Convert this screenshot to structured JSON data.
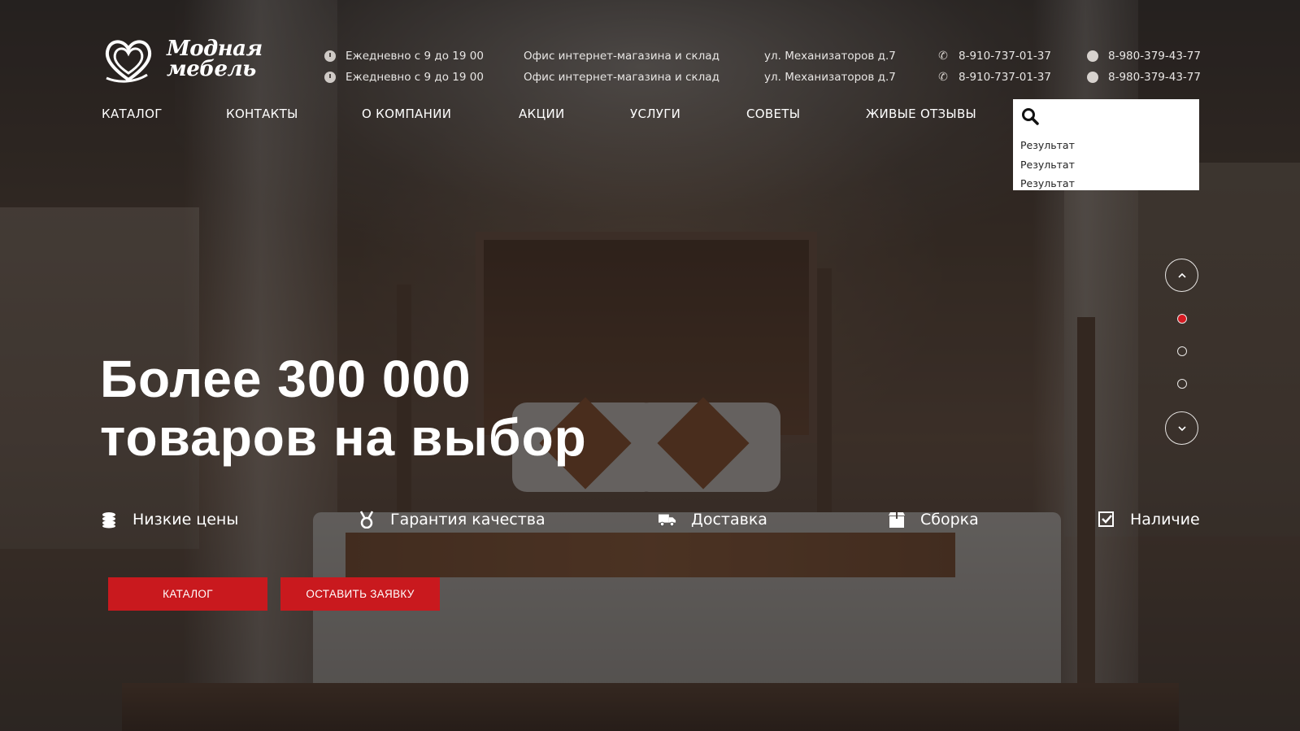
{
  "brand": {
    "line1": "Модная",
    "line2": "мебель"
  },
  "contacts": {
    "hours": [
      "Ежедневно с 9 до 19 00",
      "Ежедневно с 9 до 19 00"
    ],
    "office": [
      "Офис интернет-магазина и склад",
      "Офис интернет-магазина и склад"
    ],
    "address": [
      "ул. Механизаторов д.7",
      "ул. Механизаторов д.7"
    ],
    "phone1": [
      "8-910-737-01-37",
      "8-910-737-01-37"
    ],
    "phone2": [
      "8-980-379-43-77",
      "8-980-379-43-77"
    ]
  },
  "nav": {
    "items": [
      "КАТАЛОГ",
      "КОНТАКТЫ",
      "О КОМПАНИИ",
      "АКЦИИ",
      "УСЛУГИ",
      "СОВЕТЫ",
      "ЖИВЫЕ ОТЗЫВЫ"
    ]
  },
  "search": {
    "value": "",
    "results": [
      "Результат",
      "Результат",
      "Результат"
    ]
  },
  "hero": {
    "title_line1": "Более 300 000",
    "title_line2": "товаров на выбор"
  },
  "features": [
    {
      "label": "Низкие цены",
      "icon": "coins-icon"
    },
    {
      "label": "Гарантия качества",
      "icon": "medal-icon"
    },
    {
      "label": "Доставка",
      "icon": "truck-icon"
    },
    {
      "label": "Сборка",
      "icon": "box-icon"
    },
    {
      "label": "Наличие",
      "icon": "checkbox-icon"
    }
  ],
  "buttons": {
    "catalog": "КАТАЛОГ",
    "request": "ОСТАВИТЬ ЗАЯВКУ"
  },
  "slider": {
    "slide_count": 3,
    "active_slide": 1
  },
  "colors": {
    "accent": "#c9191e",
    "active_dot": "#d51a22",
    "text": "#ffffff"
  }
}
